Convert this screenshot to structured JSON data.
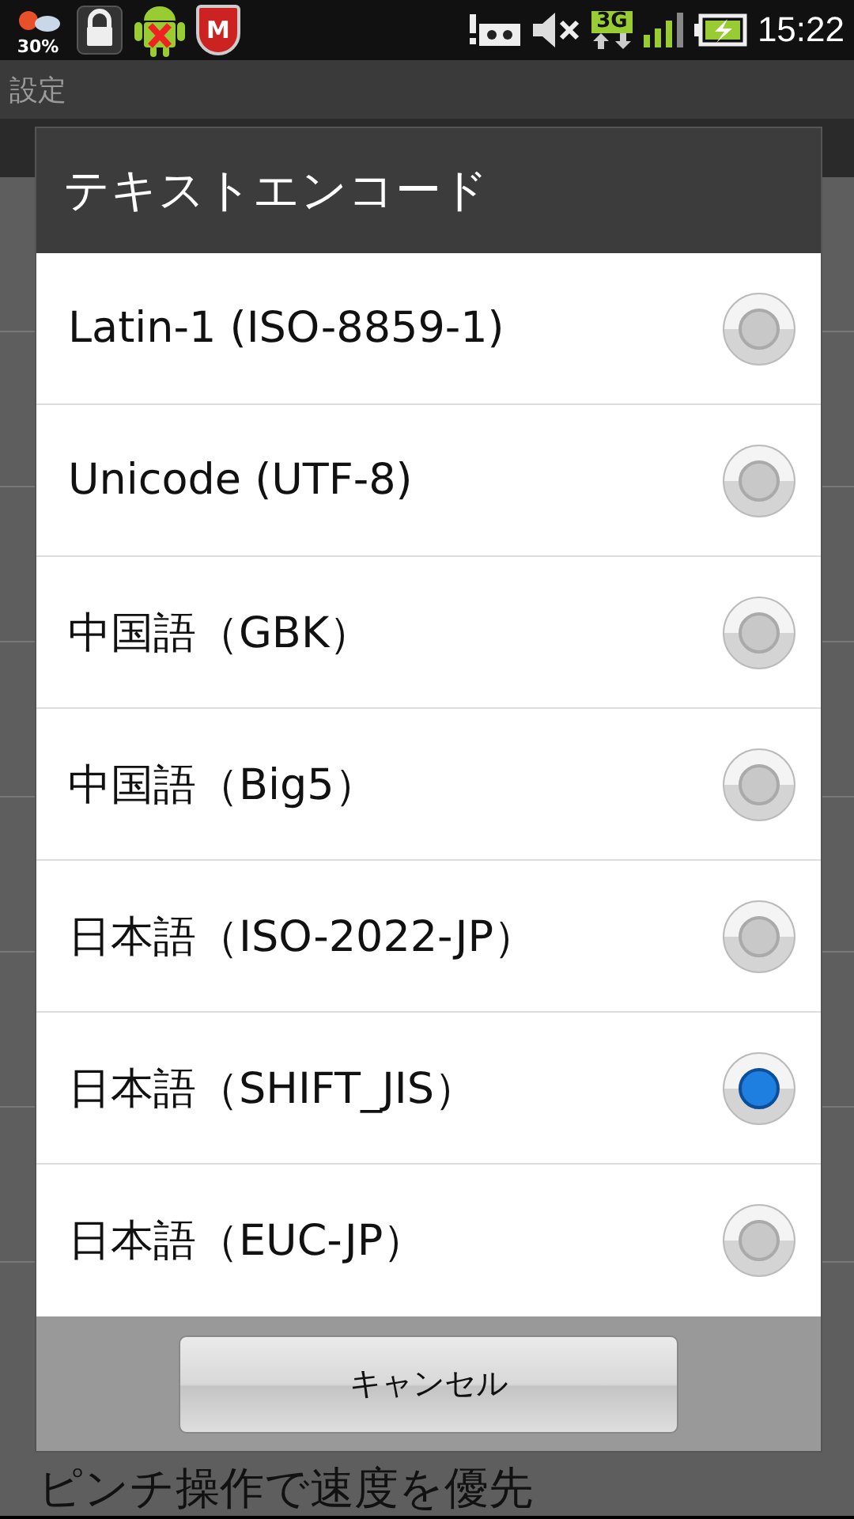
{
  "status_bar": {
    "weather_percent": "30%",
    "shield_letter": "M",
    "network": "3G",
    "time": "15:22"
  },
  "screen": {
    "title": "設定",
    "bottom_item": "ピンチ操作で速度を優先"
  },
  "dialog": {
    "title": "テキストエンコード",
    "options": [
      {
        "label": "Latin-1 (ISO-8859-1)",
        "selected": false
      },
      {
        "label": "Unicode (UTF-8)",
        "selected": false
      },
      {
        "label": "中国語（GBK）",
        "selected": false
      },
      {
        "label": "中国語（Big5）",
        "selected": false
      },
      {
        "label": "日本語（ISO-2022-JP）",
        "selected": false
      },
      {
        "label": "日本語（SHIFT_JIS）",
        "selected": true
      },
      {
        "label": "日本語（EUC-JP）",
        "selected": false
      }
    ],
    "cancel": "キャンセル"
  }
}
